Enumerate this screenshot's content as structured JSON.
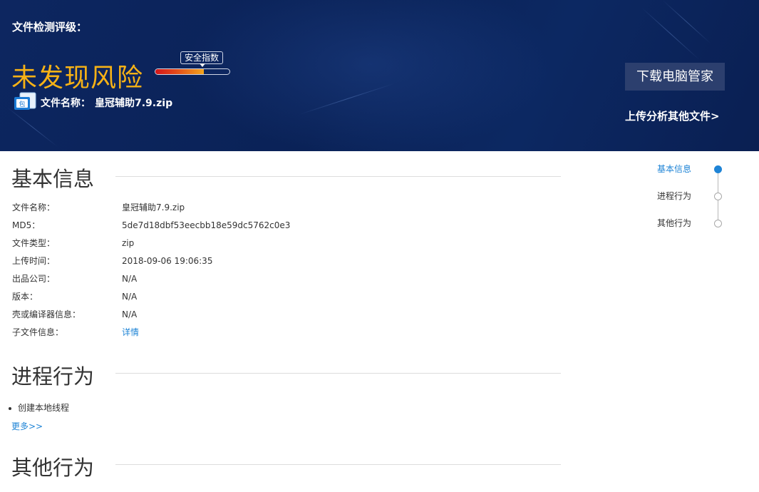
{
  "header": {
    "rating_label": "文件检测评级：",
    "verdict": "未发现风险",
    "safety_index_label": "安全指数",
    "safety_index_level": 0.65,
    "file_icon_glyph": "包",
    "file_name_label": "文件名称：",
    "file_name": "皇冠辅助7.9.zip",
    "download_button": "下载电脑管家",
    "upload_link": "上传分析其他文件>"
  },
  "colors": {
    "banner": "#0b2359",
    "verdict": "#f7b216",
    "link": "#1f84d6"
  },
  "sections": {
    "basic_info": {
      "title": "基本信息",
      "rows": [
        {
          "label": "文件名称：",
          "value": "皇冠辅助7.9.zip"
        },
        {
          "label": "MD5：",
          "value": "5de7d18dbf53eecbb18e59dc5762c0e3"
        },
        {
          "label": "文件类型：",
          "value": "zip"
        },
        {
          "label": "上传时间：",
          "value": "2018-09-06 19:06:35"
        },
        {
          "label": "出品公司：",
          "value": "N/A"
        },
        {
          "label": "版本：",
          "value": "N/A"
        },
        {
          "label": "壳或编译器信息：",
          "value": "N/A"
        },
        {
          "label": "子文件信息：",
          "value": "详情"
        }
      ]
    },
    "process_behavior": {
      "title": "进程行为",
      "items": [
        "创建本地线程"
      ],
      "more_link": "更多>>"
    },
    "other_behavior": {
      "title": "其他行为"
    }
  },
  "side_nav": {
    "items": [
      {
        "label": "基本信息",
        "active": true
      },
      {
        "label": "进程行为",
        "active": false
      },
      {
        "label": "其他行为",
        "active": false
      }
    ]
  }
}
